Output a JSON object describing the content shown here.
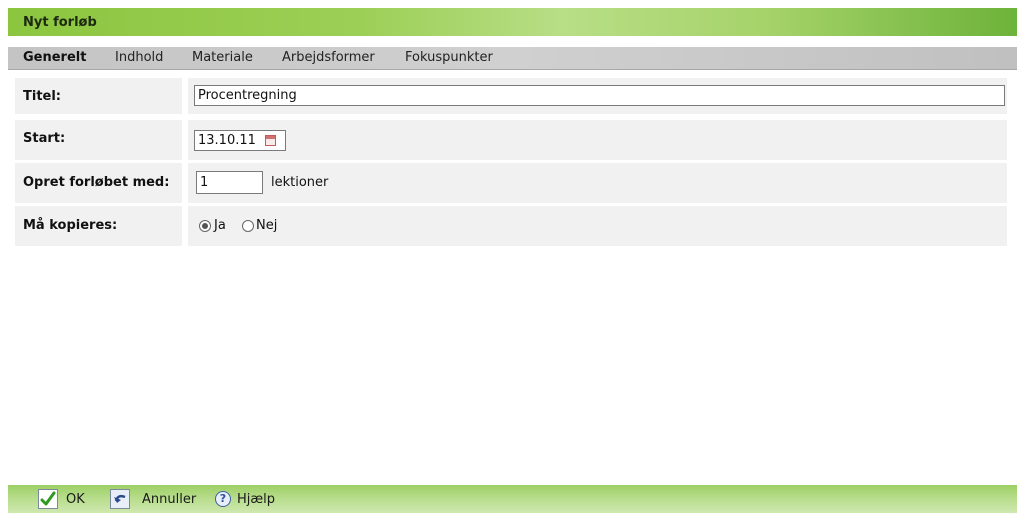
{
  "window": {
    "title": "Nyt forløb"
  },
  "tabs": [
    {
      "label": "Generelt",
      "active": true
    },
    {
      "label": "Indhold",
      "active": false
    },
    {
      "label": "Materiale",
      "active": false
    },
    {
      "label": "Arbejdsformer",
      "active": false
    },
    {
      "label": "Fokuspunkter",
      "active": false
    }
  ],
  "form": {
    "title_label": "Titel:",
    "title_value": "Procentregning",
    "start_label": "Start:",
    "start_value": "13.10.11",
    "create_label": "Opret forløbet med:",
    "create_value": "1",
    "create_unit": "lektioner",
    "copy_label": "Må kopieres:",
    "copy_options": [
      {
        "label": "Ja",
        "checked": true
      },
      {
        "label": "Nej",
        "checked": false
      }
    ]
  },
  "footer": {
    "ok_label": "OK",
    "cancel_label": "Annuller",
    "help_label": "Hjælp",
    "help_icon_glyph": "?"
  },
  "icons": {
    "calendar": "calendar-icon",
    "ok": "checkmark-icon",
    "cancel": "undo-icon",
    "help": "help-icon"
  },
  "colors": {
    "titlebar_green": "#8cc63f",
    "tabbar_gray": "#c4c4c4",
    "row_bg": "#f1f1f1",
    "footer_green": "#b6dc8a"
  }
}
